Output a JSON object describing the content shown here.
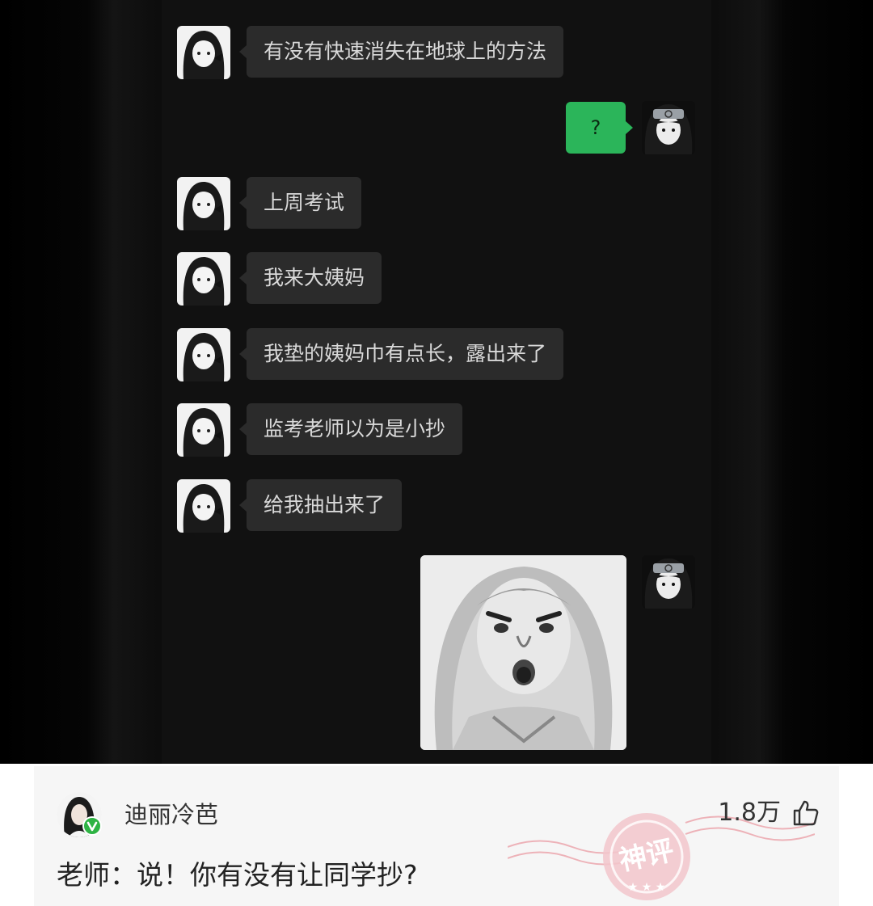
{
  "chat": {
    "messages": [
      {
        "side": "left",
        "text": "有没有快速消失在地球上的方法"
      },
      {
        "side": "right",
        "text": "?"
      },
      {
        "side": "left",
        "text": "上周考试"
      },
      {
        "side": "left",
        "text": "我来大姨妈"
      },
      {
        "side": "left",
        "text": "我垫的姨妈巾有点长，露出来了"
      },
      {
        "side": "left",
        "text": "监考老师以为是小抄"
      },
      {
        "side": "left",
        "text": "给我抽出来了"
      },
      {
        "side": "right",
        "type": "sticker",
        "icon": "shocked-face-sticker"
      }
    ],
    "colors": {
      "bubble_left": "#2b2b2b",
      "bubble_right": "#2bb55a",
      "panel": "#111111"
    }
  },
  "comment": {
    "username": "迪丽冷芭",
    "like_count": "1.8万",
    "text": "老师：说！你有没有让同学抄?",
    "badge_text": "神评",
    "icons": {
      "like": "thumbs-up-icon",
      "verify": "verified-check-icon"
    },
    "colors": {
      "verify": "#2fb344",
      "stamp": "#e8858f"
    }
  }
}
